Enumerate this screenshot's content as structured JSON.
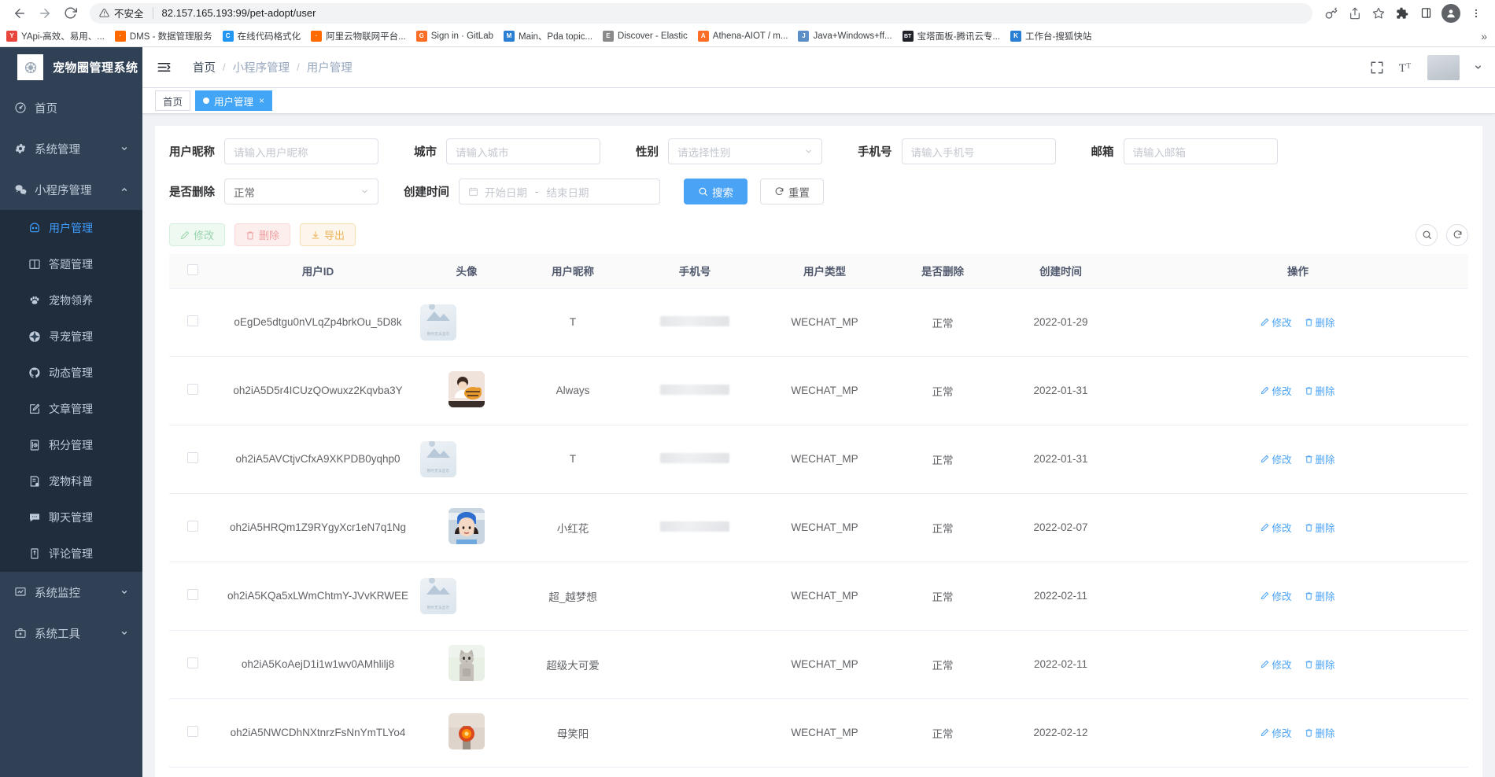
{
  "browser": {
    "nav": {
      "back": "←",
      "forward": "→",
      "reload": "⟳"
    },
    "omnibox": {
      "warning_icon": "warning-triangle-icon",
      "insecure_label": "不安全",
      "url": "82.157.165.193:99/pet-adopt/user"
    },
    "toolbar_icons": [
      "key-icon",
      "share-icon",
      "star-icon",
      "extensions-icon",
      "sidepanel-icon",
      "profile-icon",
      "menu-kebab-icon"
    ],
    "bookmarks": [
      {
        "label": "YApi-高效、易用、...",
        "fav": "Y",
        "color": "#e8453c"
      },
      {
        "label": "DMS - 数据管理服务",
        "fav": "·",
        "color": "#ff6a00"
      },
      {
        "label": "在线代码格式化",
        "fav": "C",
        "color": "#2196f3"
      },
      {
        "label": "阿里云物联网平台...",
        "fav": "·",
        "color": "#ff6a00"
      },
      {
        "label": "Sign in · GitLab",
        "fav": "G",
        "color": "#fc6d26"
      },
      {
        "label": "Main、Pda topic...",
        "fav": "M",
        "color": "#2a7fd4"
      },
      {
        "label": "Discover - Elastic",
        "fav": "E",
        "color": "#8a8a8a"
      },
      {
        "label": "Athena-AIOT / m...",
        "fav": "A",
        "color": "#fc6d26"
      },
      {
        "label": "Java+Windows+ff...",
        "fav": "J",
        "color": "#5d8fc7"
      },
      {
        "label": "宝塔面板-腾讯云专...",
        "fav": "BT",
        "color": "#20222a"
      },
      {
        "label": "工作台-搜狐快站",
        "fav": "K",
        "color": "#2a7fd4"
      }
    ],
    "overflow": "»"
  },
  "sidebar": {
    "brand": "宠物圈管理系统",
    "logo_icon": "paw-logo-icon",
    "items": [
      {
        "label": "首页",
        "icon": "dashboard-icon",
        "type": "link"
      },
      {
        "label": "系统管理",
        "icon": "gear-icon",
        "type": "group",
        "arrow": "▾"
      },
      {
        "label": "小程序管理",
        "icon": "wechat-icon",
        "type": "group",
        "arrow": "▾",
        "open": true
      },
      {
        "label": "系统监控",
        "icon": "monitor-icon",
        "type": "group",
        "arrow": "▾"
      },
      {
        "label": "系统工具",
        "icon": "toolbox-icon",
        "type": "group",
        "arrow": "▾"
      }
    ],
    "submenu": [
      {
        "label": "用户管理",
        "icon": "user-circle-icon",
        "active": true
      },
      {
        "label": "答题管理",
        "icon": "book-icon",
        "active": false
      },
      {
        "label": "宠物领养",
        "icon": "pet-icon",
        "active": false
      },
      {
        "label": "寻宠管理",
        "icon": "compass-icon",
        "active": false
      },
      {
        "label": "动态管理",
        "icon": "github-icon",
        "active": false
      },
      {
        "label": "文章管理",
        "icon": "edit-square-icon",
        "active": false
      },
      {
        "label": "积分管理",
        "icon": "score-icon",
        "active": false
      },
      {
        "label": "宠物科普",
        "icon": "document-icon",
        "active": false
      },
      {
        "label": "聊天管理",
        "icon": "chat-bubble-icon",
        "active": false
      },
      {
        "label": "评论管理",
        "icon": "comment-icon",
        "active": false
      }
    ]
  },
  "navbar": {
    "hamburger_icon": "hamburger-fold-icon",
    "breadcrumb": [
      "首页",
      "小程序管理",
      "用户管理"
    ],
    "breadcrumb_sep": "/",
    "right_icons": [
      "fullscreen-icon",
      "font-size-icon",
      "avatar",
      "chevron-down-icon"
    ]
  },
  "tags": [
    {
      "label": "首页",
      "active": false,
      "closable": false
    },
    {
      "label": "用户管理",
      "active": true,
      "closable": true,
      "close": "×"
    }
  ],
  "search_form": {
    "row1": [
      {
        "label": "用户昵称",
        "placeholder": "请输入用户昵称",
        "value": "",
        "kind": "input",
        "name": "nickname"
      },
      {
        "label": "城市",
        "placeholder": "请输入城市",
        "value": "",
        "kind": "input",
        "name": "city"
      },
      {
        "label": "性别",
        "placeholder": "请选择性别",
        "value": "",
        "kind": "select",
        "name": "gender"
      },
      {
        "label": "手机号",
        "placeholder": "请输入手机号",
        "value": "",
        "kind": "input",
        "name": "phone"
      },
      {
        "label": "邮箱",
        "placeholder": "请输入邮箱",
        "value": "",
        "kind": "input",
        "name": "email"
      }
    ],
    "deleted": {
      "label": "是否删除",
      "value": "正常",
      "kind": "select",
      "name": "deleted"
    },
    "created": {
      "label": "创建时间",
      "start_placeholder": "开始日期",
      "end_placeholder": "结束日期",
      "separator": "-",
      "icon": "calendar-icon"
    },
    "search_button": {
      "label": "搜索",
      "icon": "search-icon"
    },
    "reset_button": {
      "label": "重置",
      "icon": "refresh-icon"
    }
  },
  "table_toolbar": {
    "edit": {
      "label": "修改",
      "icon": "pencil-icon"
    },
    "delete": {
      "label": "删除",
      "icon": "trash-icon"
    },
    "export": {
      "label": "导出",
      "icon": "download-icon"
    },
    "search_toggle_icon": "search-icon",
    "refresh_icon": "refresh-icon"
  },
  "table": {
    "columns": [
      "",
      "用户ID",
      "头像",
      "用户昵称",
      "手机号",
      "用户类型",
      "是否删除",
      "创建时间",
      "操作"
    ],
    "row_actions": {
      "edit": {
        "label": "修改",
        "icon": "pencil-icon"
      },
      "delete": {
        "label": "删除",
        "icon": "trash-icon"
      }
    },
    "rows": [
      {
        "id": "oEgDe5dtgu0nVLqZp4brkOu_5D8k",
        "avatar": "placeholder",
        "nickname": "T",
        "phone": "masked",
        "type": "WECHAT_MP",
        "deleted": "正常",
        "created": "2022-01-29"
      },
      {
        "id": "oh2iA5D5r4ICUzQOwuxz2Kqvba3Y",
        "avatar": "photo-boy-tiger",
        "nickname": "Always",
        "phone": "masked",
        "type": "WECHAT_MP",
        "deleted": "正常",
        "created": "2022-01-31"
      },
      {
        "id": "oh2iA5AVCtjvCfxA9XKPDB0yqhp0",
        "avatar": "placeholder",
        "nickname": "T",
        "phone": "masked",
        "type": "WECHAT_MP",
        "deleted": "正常",
        "created": "2022-01-31"
      },
      {
        "id": "oh2iA5HRQm1Z9RYgyXcr1eN7q1Ng",
        "avatar": "photo-girl-cap",
        "nickname": "小红花",
        "phone": "masked",
        "type": "WECHAT_MP",
        "deleted": "正常",
        "created": "2022-02-07"
      },
      {
        "id": "oh2iA5KQa5xLWmChtmY-JVvKRWEE",
        "avatar": "placeholder",
        "nickname": "超_越梦想",
        "phone": "",
        "type": "WECHAT_MP",
        "deleted": "正常",
        "created": "2022-02-11"
      },
      {
        "id": "oh2iA5KoAejD1i1w1wv0AMhlilj8",
        "avatar": "photo-cat",
        "nickname": "超级大可爱",
        "phone": "",
        "type": "WECHAT_MP",
        "deleted": "正常",
        "created": "2022-02-11"
      },
      {
        "id": "oh2iA5NWCDhNXtnrzFsNnYmTLYo4",
        "avatar": "photo-lamp",
        "nickname": "母笑阳",
        "phone": "",
        "type": "WECHAT_MP",
        "deleted": "正常",
        "created": "2022-02-12"
      }
    ],
    "avatar_placeholder_text": "暂时无法显示"
  },
  "colors": {
    "sidebar_bg": "#304156",
    "submenu_bg": "#1f2d3d",
    "accent": "#409eff",
    "tag_active": "#42a5f5",
    "link": "#4aa3f5"
  }
}
